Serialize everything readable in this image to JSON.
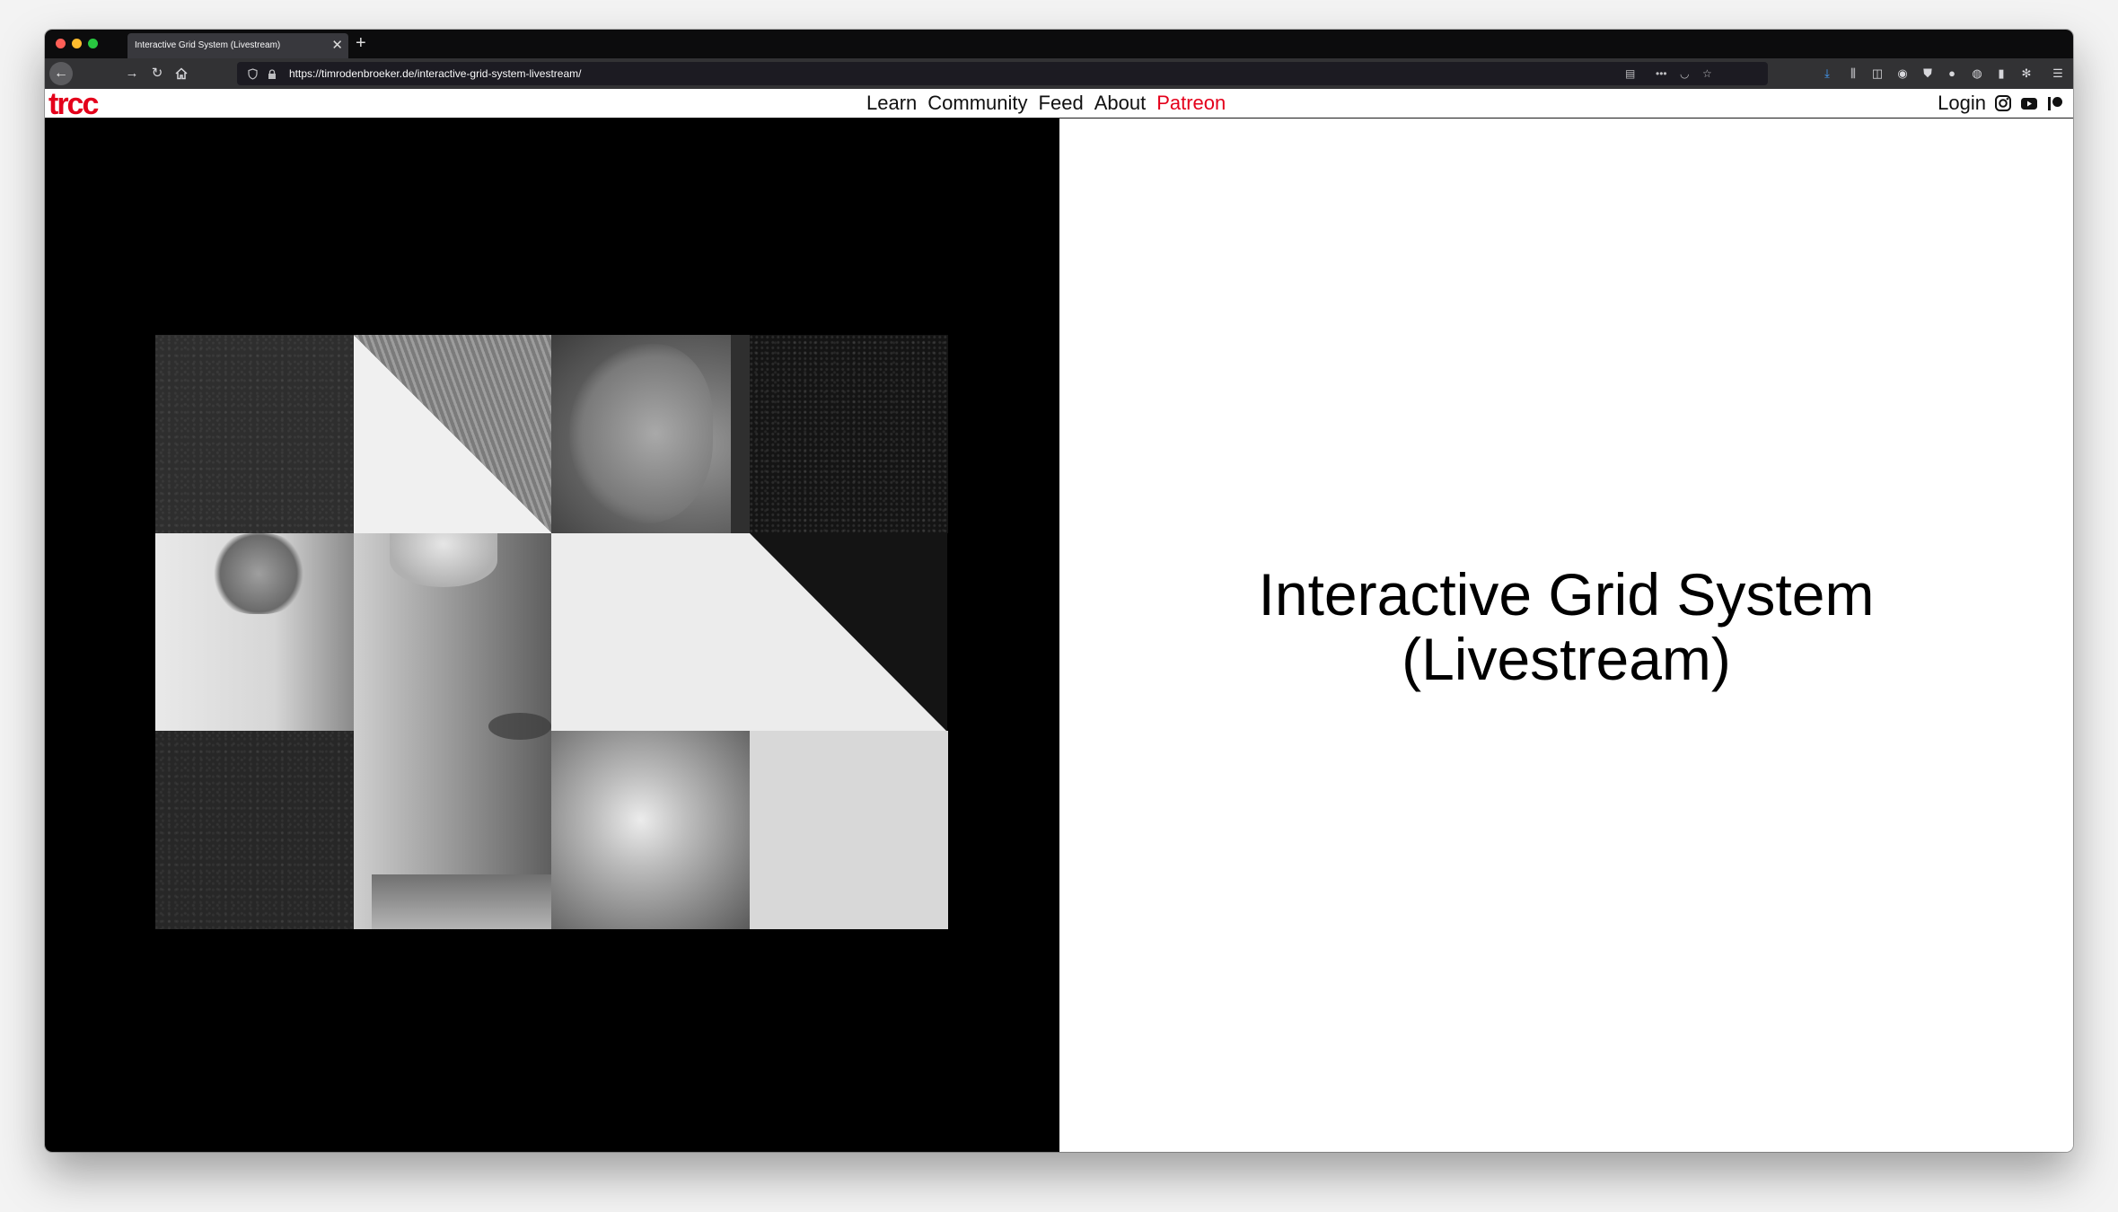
{
  "browser": {
    "tab_title": "Interactive Grid System (Livestream)",
    "tab_close": "✕",
    "new_tab": "+",
    "url": "https://timrodenbroeker.de/interactive-grid-system-livestream/"
  },
  "site": {
    "logo": "trcc",
    "menu": {
      "learn": "Learn",
      "community": "Community",
      "feed": "Feed",
      "about": "About",
      "patreon": "Patreon"
    },
    "login": "Login",
    "accent_color": "#e4001b"
  },
  "hero": {
    "title_line1": "Interactive Grid System",
    "title_line2": "(Livestream)"
  },
  "icons": {
    "back": "arrow-left-icon",
    "forward": "arrow-right-icon",
    "reload": "reload-icon",
    "home": "home-icon",
    "instagram": "instagram-icon",
    "youtube": "youtube-icon",
    "patreon": "patreon-icon"
  }
}
